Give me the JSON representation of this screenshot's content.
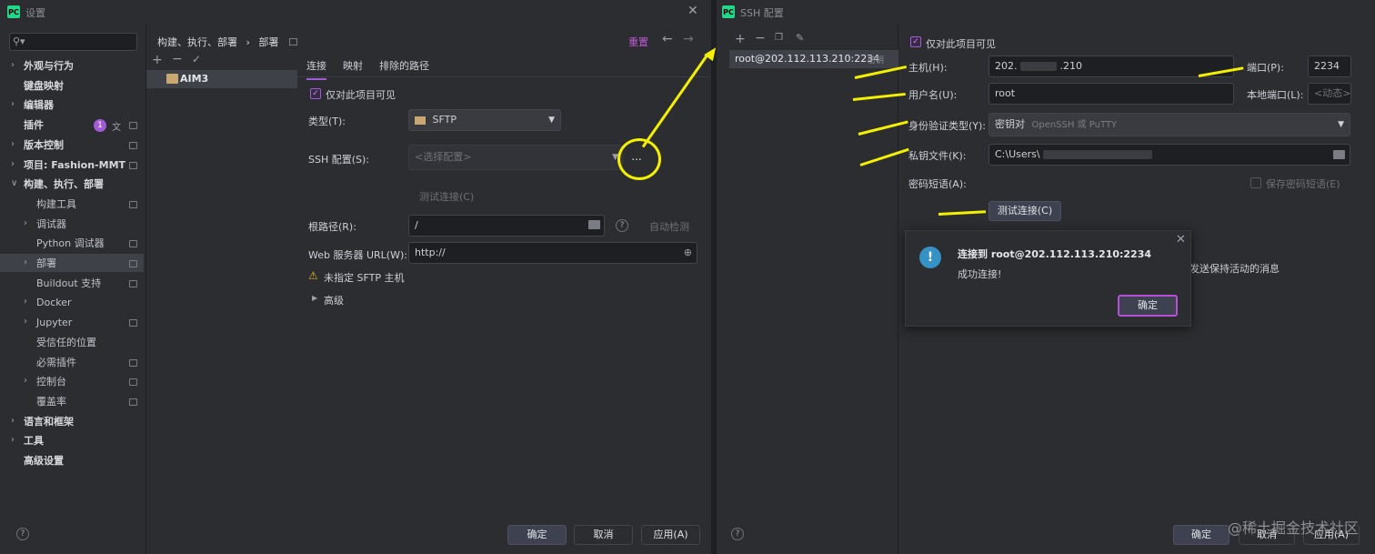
{
  "settings_window": {
    "title": "设置",
    "breadcrumb": [
      "构建、执行、部署",
      "部署"
    ],
    "reset_label": "重置",
    "sidebar": [
      {
        "label": "外观与行为",
        "arrow": true
      },
      {
        "label": "键盘映射",
        "arrow": false
      },
      {
        "label": "编辑器",
        "arrow": true
      },
      {
        "label": "插件",
        "arrow": false,
        "badge": "1"
      },
      {
        "label": "版本控制",
        "arrow": true
      },
      {
        "label": "项目: Fashion-MMT",
        "arrow": true
      },
      {
        "label": "构建、执行、部署",
        "arrow": true,
        "expanded": true
      },
      {
        "label": "构建工具",
        "arrow": false,
        "sub": true
      },
      {
        "label": "调试器",
        "arrow": true,
        "sub": true
      },
      {
        "label": "Python 调试器",
        "arrow": false,
        "sub": true
      },
      {
        "label": "部署",
        "arrow": true,
        "sub": true,
        "selected": true
      },
      {
        "label": "Buildout 支持",
        "arrow": false,
        "sub": true
      },
      {
        "label": "Docker",
        "arrow": true,
        "sub": true
      },
      {
        "label": "Jupyter",
        "arrow": true,
        "sub": true
      },
      {
        "label": "受信任的位置",
        "arrow": false,
        "sub": true
      },
      {
        "label": "必需插件",
        "arrow": false,
        "sub": true
      },
      {
        "label": "控制台",
        "arrow": true,
        "sub": true
      },
      {
        "label": "覆盖率",
        "arrow": false,
        "sub": true
      },
      {
        "label": "语言和框架",
        "arrow": true
      },
      {
        "label": "工具",
        "arrow": true
      },
      {
        "label": "高级设置",
        "arrow": false
      }
    ],
    "server_list": [
      "AIM3"
    ],
    "tabs": [
      "连接",
      "映射",
      "排除的路径"
    ],
    "visible_only_label": "仅对此项目可见",
    "type_label": "类型(T):",
    "type_value": "SFTP",
    "ssh_config_label": "SSH 配置(S):",
    "ssh_config_placeholder": "<选择配置>",
    "ellipsis": "...",
    "test_connection_label": "测试连接(C)",
    "root_path_label": "根路径(R):",
    "root_path_value": "/",
    "auto_detect_label": "自动检测",
    "web_url_label": "Web 服务器 URL(W):",
    "web_url_value": "http://",
    "warning_text": "未指定 SFTP 主机",
    "advanced_label": "高级",
    "ok_label": "确定",
    "cancel_label": "取消",
    "apply_label": "应用(A)"
  },
  "ssh_window": {
    "title": "SSH 配置",
    "connection_item": "root@202.112.113.210:2234",
    "connection_tag": "密钥",
    "visible_only_label": "仅对此项目可见",
    "host_label": "主机(H):",
    "host_value_prefix": "202.",
    "host_value_suffix": ".210",
    "port_label": "端口(P):",
    "port_value": "2234",
    "username_label": "用户名(U):",
    "username_value": "root",
    "local_port_label": "本地端口(L):",
    "local_port_placeholder": "<动态>",
    "auth_type_label": "身份验证类型(Y):",
    "auth_type_value": "密钥对",
    "auth_type_hint": "OpenSSH 或 PuTTY",
    "key_file_label": "私钥文件(K):",
    "key_file_value": "C:\\Users\\",
    "passphrase_label": "密码短语(A):",
    "save_passphrase_label": "保存密码短语(E)",
    "test_connection_label": "测试连接(C)",
    "keepalive_text": "发送保持活动的消息",
    "ok_label": "确定",
    "cancel_label": "取消",
    "apply_label": "应用(A)"
  },
  "dialog": {
    "title": "连接到 root@202.112.113.210:2234",
    "message": "成功连接!",
    "ok_label": "确定"
  },
  "watermark": "@稀土掘金技术社区",
  "colors": {
    "accent": "#a15bd6",
    "annotation": "#f4f000",
    "info": "#3592c4"
  }
}
